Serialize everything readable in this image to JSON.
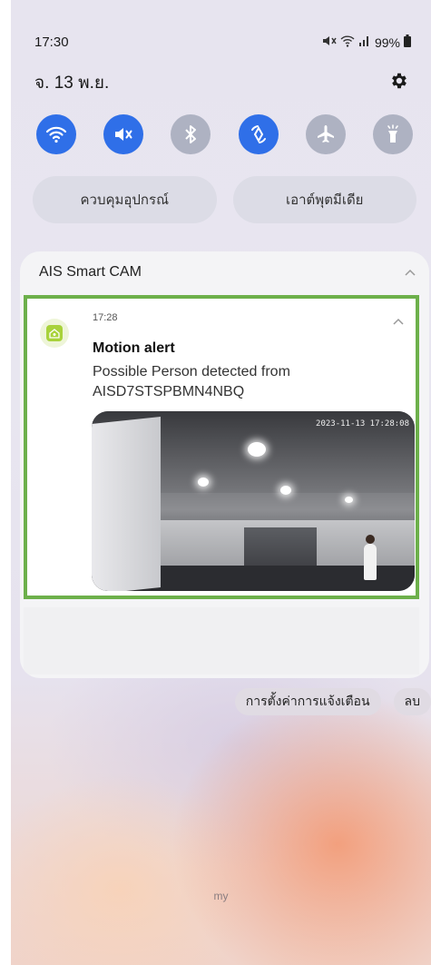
{
  "status_bar": {
    "time": "17:30",
    "battery": "99%",
    "icons": [
      "mute-icon",
      "wifi-icon",
      "signal-icon",
      "battery-icon"
    ]
  },
  "header": {
    "date": "จ. 13 พ.ย.",
    "settings_icon": "gear-icon"
  },
  "quick_settings": [
    {
      "name": "wifi",
      "icon": "wifi-icon",
      "state": "on"
    },
    {
      "name": "sound",
      "icon": "mute-icon",
      "state": "on"
    },
    {
      "name": "bluetooth",
      "icon": "bluetooth-icon",
      "state": "off"
    },
    {
      "name": "auto-rotate",
      "icon": "rotate-icon",
      "state": "on"
    },
    {
      "name": "airplane",
      "icon": "airplane-icon",
      "state": "off"
    },
    {
      "name": "flashlight",
      "icon": "flashlight-icon",
      "state": "off"
    }
  ],
  "pills": {
    "device_control": "ควบคุมอุปกรณ์",
    "media_output": "เอาต์พุตมีเดีย"
  },
  "notification_group": {
    "app_name": "AIS Smart CAM",
    "notification": {
      "time": "17:28",
      "title": "Motion alert",
      "body": "Possible Person detected from AISD7STSPBMN4NBQ",
      "image_timestamp": "2023-11-13 17:28:08"
    }
  },
  "actions": {
    "notification_settings": "การตั้งค่าการแจ้งเตือน",
    "clear": "ลบ"
  },
  "carrier_label": "my",
  "colors": {
    "accent_on": "#2f6fe8",
    "toggle_off": "#aeb2c2",
    "highlight_border": "#6db04b"
  }
}
